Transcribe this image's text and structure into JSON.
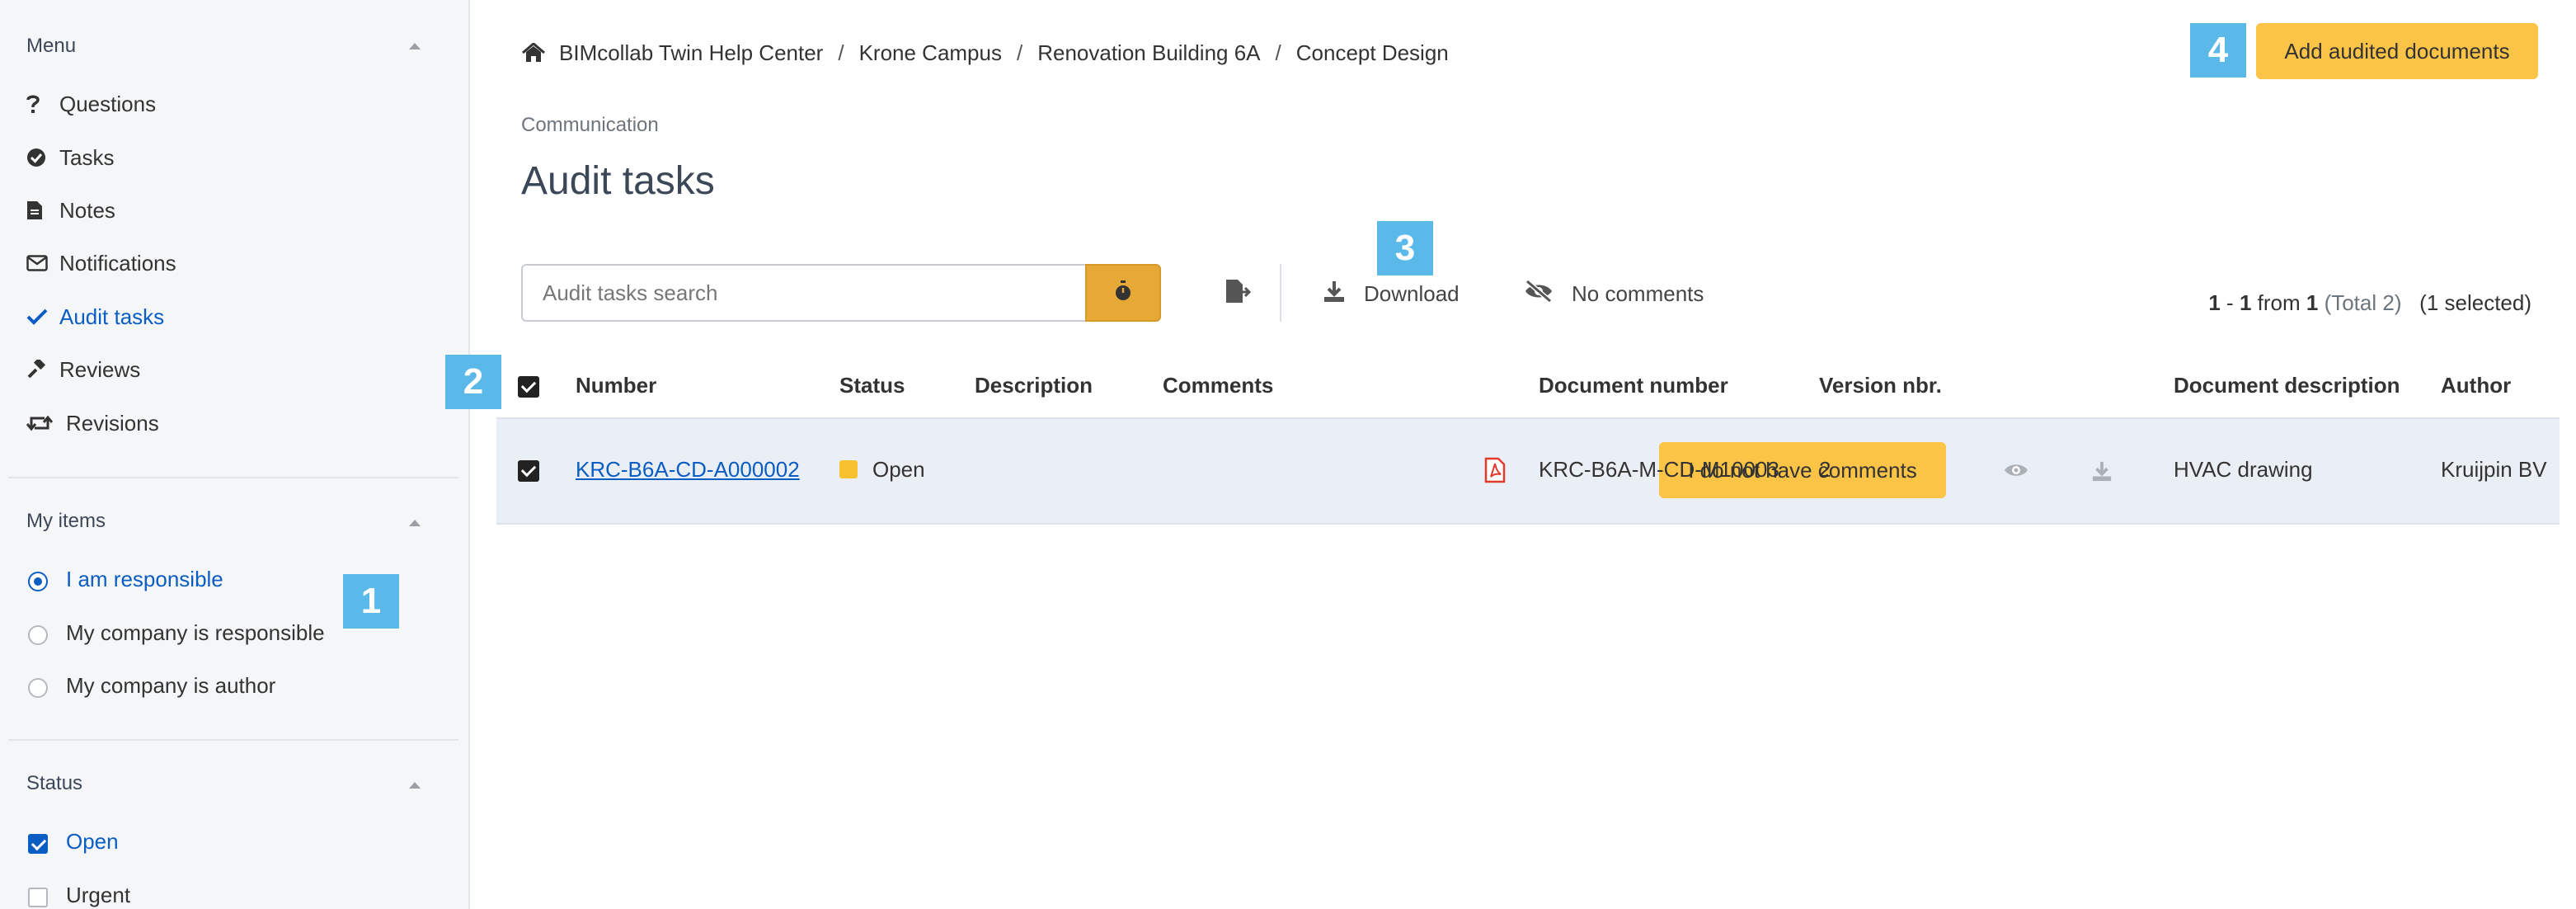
{
  "sidebar": {
    "menu": {
      "heading": "Menu",
      "items": [
        {
          "label": "Questions",
          "icon": "question-icon",
          "active": false
        },
        {
          "label": "Tasks",
          "icon": "check-circle-icon",
          "active": false
        },
        {
          "label": "Notes",
          "icon": "file-icon",
          "active": false
        },
        {
          "label": "Notifications",
          "icon": "envelope-icon",
          "active": false
        },
        {
          "label": "Audit tasks",
          "icon": "check-icon",
          "active": true
        },
        {
          "label": "Reviews",
          "icon": "gavel-icon",
          "active": false
        },
        {
          "label": "Revisions",
          "icon": "retweet-icon",
          "active": false
        }
      ]
    },
    "my_items": {
      "heading": "My items",
      "options": [
        {
          "label": "I am responsible",
          "selected": true
        },
        {
          "label": "My company is responsible",
          "selected": false
        },
        {
          "label": "My company is author",
          "selected": false
        }
      ]
    },
    "status": {
      "heading": "Status",
      "options": [
        {
          "label": "Open",
          "checked": true
        },
        {
          "label": "Urgent",
          "checked": false
        }
      ]
    }
  },
  "badges": [
    "1",
    "2",
    "3",
    "4"
  ],
  "breadcrumb": [
    "BIMcollab Twin Help Center",
    "Krone Campus",
    "Renovation Building 6A",
    "Concept Design"
  ],
  "breadcrumb_separator": "/",
  "header": {
    "add_button": "Add audited documents",
    "section": "Communication",
    "title": "Audit tasks"
  },
  "toolbar": {
    "search_placeholder": "Audit tasks search",
    "download_label": "Download",
    "no_comments_label": "No comments"
  },
  "pager": {
    "range_start": "1",
    "range_dash": " - ",
    "range_end": "1",
    "from_text": " from ",
    "total_count": "1",
    "total_text": "(Total 2)",
    "selected_text": "(1 selected)"
  },
  "table": {
    "columns": [
      "Number",
      "Status",
      "Description",
      "Comments",
      "Document number",
      "Version nbr.",
      "Document description",
      "Author"
    ],
    "rows": [
      {
        "selected": true,
        "number": "KRC-B6A-CD-A000002",
        "status": "Open",
        "description": "",
        "comment_button": "I do not have comments",
        "document_number": "KRC-B6A-M-CD-M10003",
        "version": "2",
        "document_description": "HVAC drawing",
        "author": "Kruijpin BV"
      }
    ]
  },
  "colors": {
    "accent_blue": "#0a5dc2",
    "button_yellow": "#fbc447",
    "badge_blue": "#5bb9ea",
    "status_open": "#f7c22e",
    "row_highlight": "#eaeef5"
  }
}
